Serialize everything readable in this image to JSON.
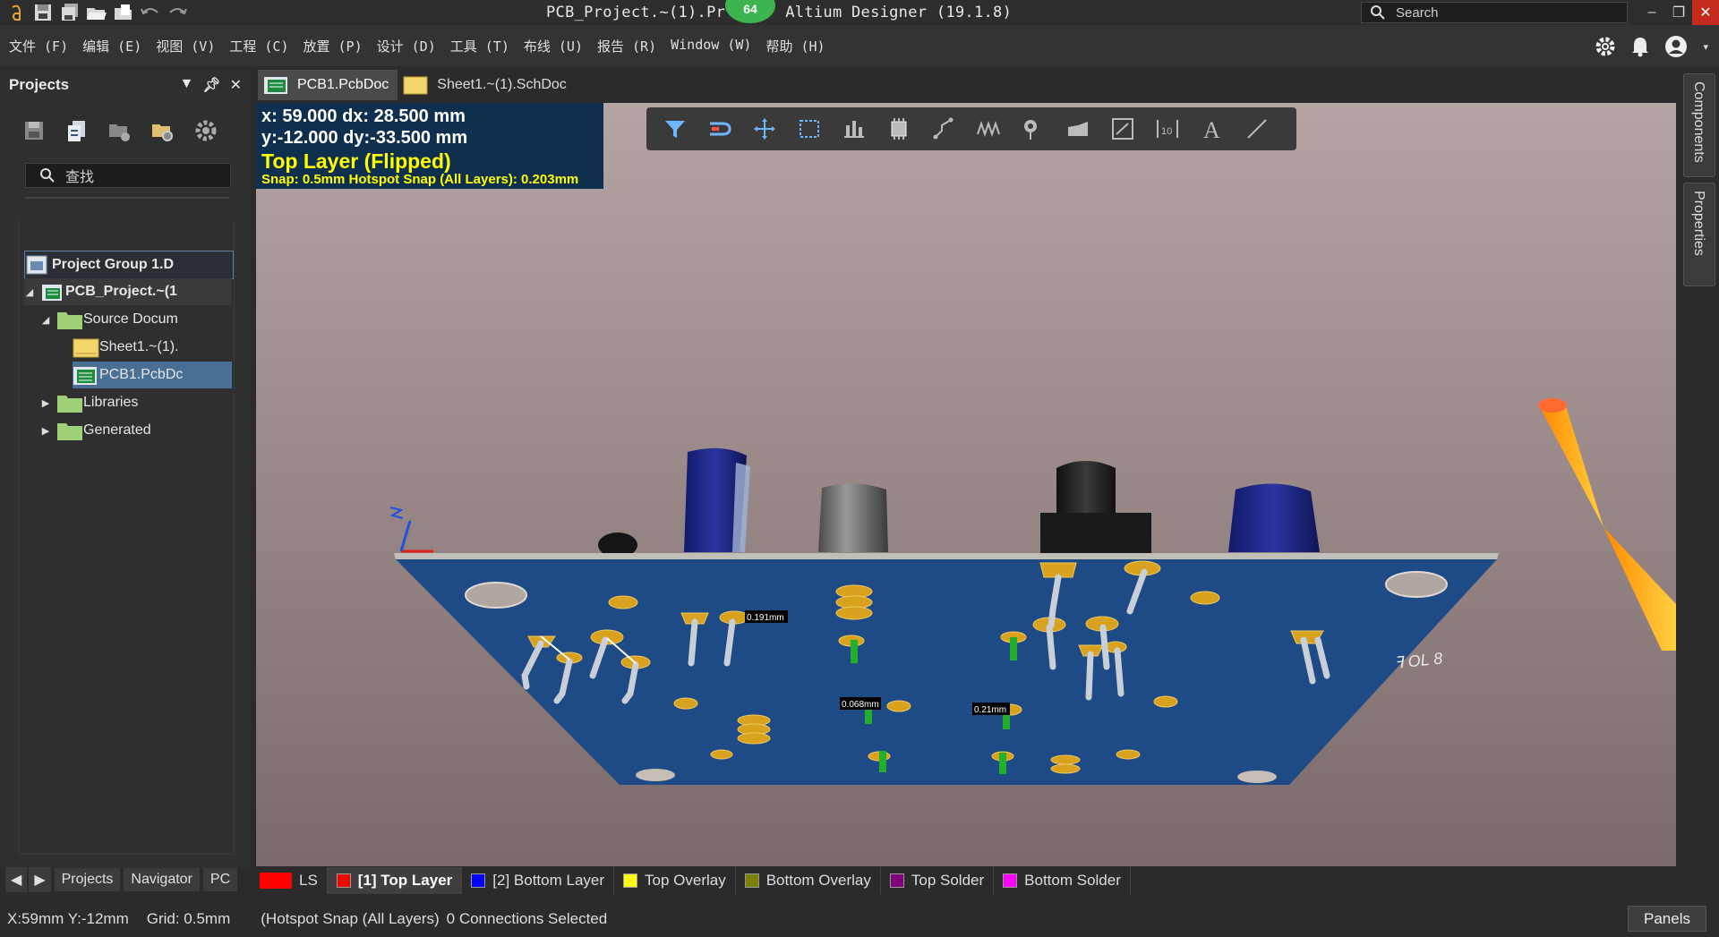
{
  "window": {
    "title": "PCB_Project.~(1).Pr",
    "title_rest": "Altium Designer (19.1.8)",
    "badge": "64",
    "search_placeholder": "Search"
  },
  "menu": [
    "文件 (F)",
    "编辑 (E)",
    "视图 (V)",
    "工程 (C)",
    "放置 (P)",
    "设计 (D)",
    "工具 (T)",
    "布线 (U)",
    "报告 (R)",
    "Window (W)",
    "帮助 (H)"
  ],
  "projects_panel": {
    "title": "Projects",
    "search_placeholder": "查找",
    "tree": [
      {
        "label": "Project Group 1.D"
      },
      {
        "label": "PCB_Project.~(1"
      },
      {
        "label": "Source Docum"
      },
      {
        "label": "Sheet1.~(1)."
      },
      {
        "label": "PCB1.PcbDc"
      },
      {
        "label": "Libraries"
      },
      {
        "label": "Generated"
      }
    ],
    "tabs": [
      "Projects",
      "Navigator",
      "PC"
    ]
  },
  "doc_tabs": [
    {
      "label": "PCB1.PcbDoc",
      "active": true
    },
    {
      "label": "Sheet1.~(1).SchDoc",
      "active": false
    }
  ],
  "hud": {
    "line1": "x: 59.000   dx: 28.500 mm",
    "line2": "y:-12.000   dy:-33.500 mm",
    "line3": "Top Layer (Flipped)",
    "line4": "Snap: 0.5mm Hotspot Snap (All Layers): 0.203mm"
  },
  "board_labels": {
    "dim1": "0.191mm",
    "dim2": "0.068mm",
    "dim3": "0.21mm",
    "silk": "ꟻ OL 8"
  },
  "right_panels": [
    "Components",
    "Properties"
  ],
  "layers": [
    {
      "label": "LS",
      "color": "#ff0000"
    },
    {
      "label": "[1] Top Layer",
      "color": "#ff0000",
      "active": true
    },
    {
      "label": "[2] Bottom Layer",
      "color": "#0000ff"
    },
    {
      "label": "Top Overlay",
      "color": "#ffff00"
    },
    {
      "label": "Bottom Overlay",
      "color": "#808000"
    },
    {
      "label": "Top Solder",
      "color": "#800080"
    },
    {
      "label": "Bottom Solder",
      "color": "#ff00ff"
    }
  ],
  "status": {
    "coords": "X:59mm Y:-12mm",
    "grid": "Grid: 0.5mm",
    "snap": "(Hotspot Snap (All Layers)",
    "connections": "0 Connections Selected",
    "panels_button": "Panels"
  }
}
